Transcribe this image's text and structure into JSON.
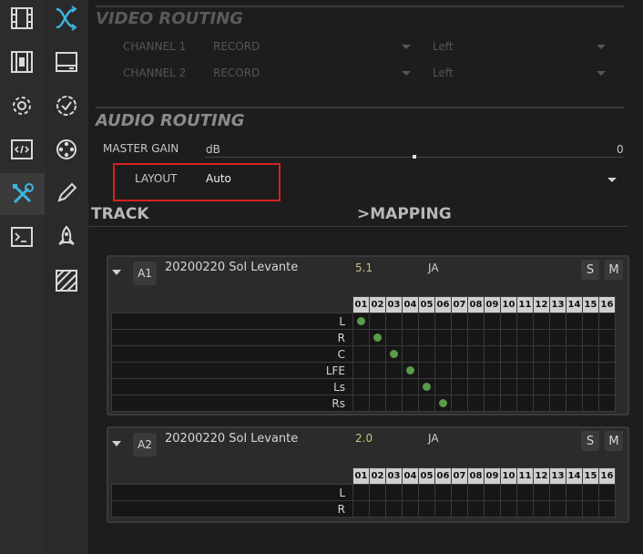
{
  "sidebar_primary": {
    "items": [
      {
        "icon": "film-icon"
      },
      {
        "icon": "film-edit-icon"
      },
      {
        "icon": "gear-icon"
      },
      {
        "icon": "code-icon"
      },
      {
        "icon": "tools-icon"
      },
      {
        "icon": "terminal-icon"
      }
    ],
    "active_index": 4
  },
  "sidebar_secondary": {
    "items": [
      {
        "icon": "routing-icon"
      },
      {
        "icon": "tray-icon"
      },
      {
        "icon": "check-badge-icon"
      },
      {
        "icon": "film-reel-icon"
      },
      {
        "icon": "pen-icon"
      },
      {
        "icon": "rocket-icon"
      },
      {
        "icon": "hatch-icon"
      }
    ],
    "active_index": 0,
    "accent_color": "#3fb5e0"
  },
  "video_routing": {
    "title": "VIDEO ROUTING",
    "channels": [
      {
        "label": "CHANNEL 1",
        "mode": "RECORD",
        "side": "Left"
      },
      {
        "label": "CHANNEL 2",
        "mode": "RECORD",
        "side": "Left"
      }
    ]
  },
  "audio_routing": {
    "title": "AUDIO ROUTING",
    "master_gain_label": "MASTER GAIN",
    "gain_unit": "dB",
    "gain_value": "0",
    "layout_label": "LAYOUT",
    "layout_value": "Auto"
  },
  "columns": {
    "track": "TRACK",
    "mapping": ">MAPPING"
  },
  "channel_numbers": [
    "01",
    "02",
    "03",
    "04",
    "05",
    "06",
    "07",
    "08",
    "09",
    "10",
    "11",
    "12",
    "13",
    "14",
    "15",
    "16"
  ],
  "tracks": [
    {
      "id": "A1",
      "name": "20200220 Sol Levante",
      "format": "5.1",
      "language": "JA",
      "solo": "S",
      "mute": "M",
      "channels": [
        "L",
        "R",
        "C",
        "LFE",
        "Ls",
        "Rs"
      ],
      "mapping": [
        0,
        1,
        2,
        3,
        4,
        5
      ]
    },
    {
      "id": "A2",
      "name": "20200220 Sol Levante",
      "format": "2.0",
      "language": "JA",
      "solo": "S",
      "mute": "M",
      "channels": [
        "L",
        "R"
      ],
      "mapping": []
    }
  ],
  "colors": {
    "highlight_box": "#d42121",
    "dot": "#5a9a4a",
    "format": "#c9c27a"
  }
}
